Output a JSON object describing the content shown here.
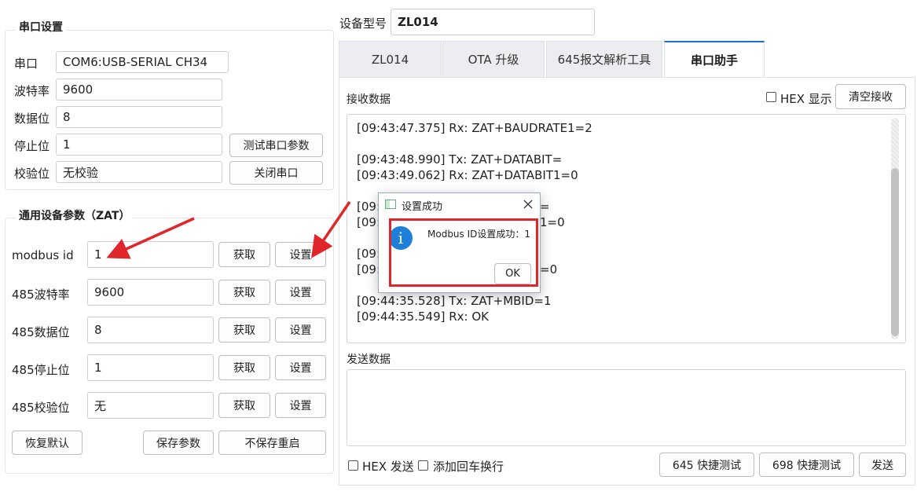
{
  "serial": {
    "title": "串口设置",
    "port_label": "串口",
    "port_value": "COM6:USB-SERIAL CH34",
    "baud_label": "波特率",
    "baud_value": "9600",
    "databits_label": "数据位",
    "databits_value": "8",
    "stopbits_label": "停止位",
    "stopbits_value": "1",
    "parity_label": "校验位",
    "parity_value": "无校验",
    "test_button": "测试串口参数",
    "close_button": "关闭串口"
  },
  "params": {
    "title": "通用设备参数（ZAT）",
    "get_label": "获取",
    "set_label": "设置",
    "rows": [
      {
        "label": "modbus id",
        "value": "1"
      },
      {
        "label": "485波特率",
        "value": "9600"
      },
      {
        "label": "485数据位",
        "value": "8"
      },
      {
        "label": "485停止位",
        "value": "1"
      },
      {
        "label": "485校验位",
        "value": "无"
      }
    ],
    "restore_button": "恢复默认",
    "save_button": "保存参数",
    "reboot_button": "不保存重启"
  },
  "device": {
    "label": "设备型号",
    "value": "ZL014"
  },
  "tabs": [
    {
      "label": "ZL014"
    },
    {
      "label": "OTA 升级"
    },
    {
      "label": "645报文解析工具"
    },
    {
      "label": "串口助手"
    }
  ],
  "receive": {
    "label": "接收数据",
    "hex_label": "HEX 显示",
    "clear_button": "清空接收",
    "lines": [
      "[09:43:47.375] Rx: ZAT+BAUDRATE1=2",
      "[09:43:48.990] Tx: ZAT+DATABIT=",
      "[09:43:49.062] Rx: ZAT+DATABIT1=0",
      "[09:",
      "=",
      "[09:",
      "1=0",
      "[09:",
      "[09:",
      "=0",
      "[09:44:35.528] Tx: ZAT+MBID=1",
      "[09:44:35.549] Rx: OK"
    ]
  },
  "send": {
    "label": "发送数据",
    "hex_label": "HEX 发送",
    "crlf_label": "添加回车换行",
    "test645_button": "645 快捷测试",
    "test698_button": "698 快捷测试",
    "send_button": "发送"
  },
  "dialog": {
    "title": "设置成功",
    "message": "Modbus ID设置成功：1",
    "ok_button": "OK",
    "info_glyph": "i"
  },
  "colors": {
    "accent": "#1f6fd1",
    "highlight": "#e0262b",
    "info": "#1e7fd8"
  }
}
